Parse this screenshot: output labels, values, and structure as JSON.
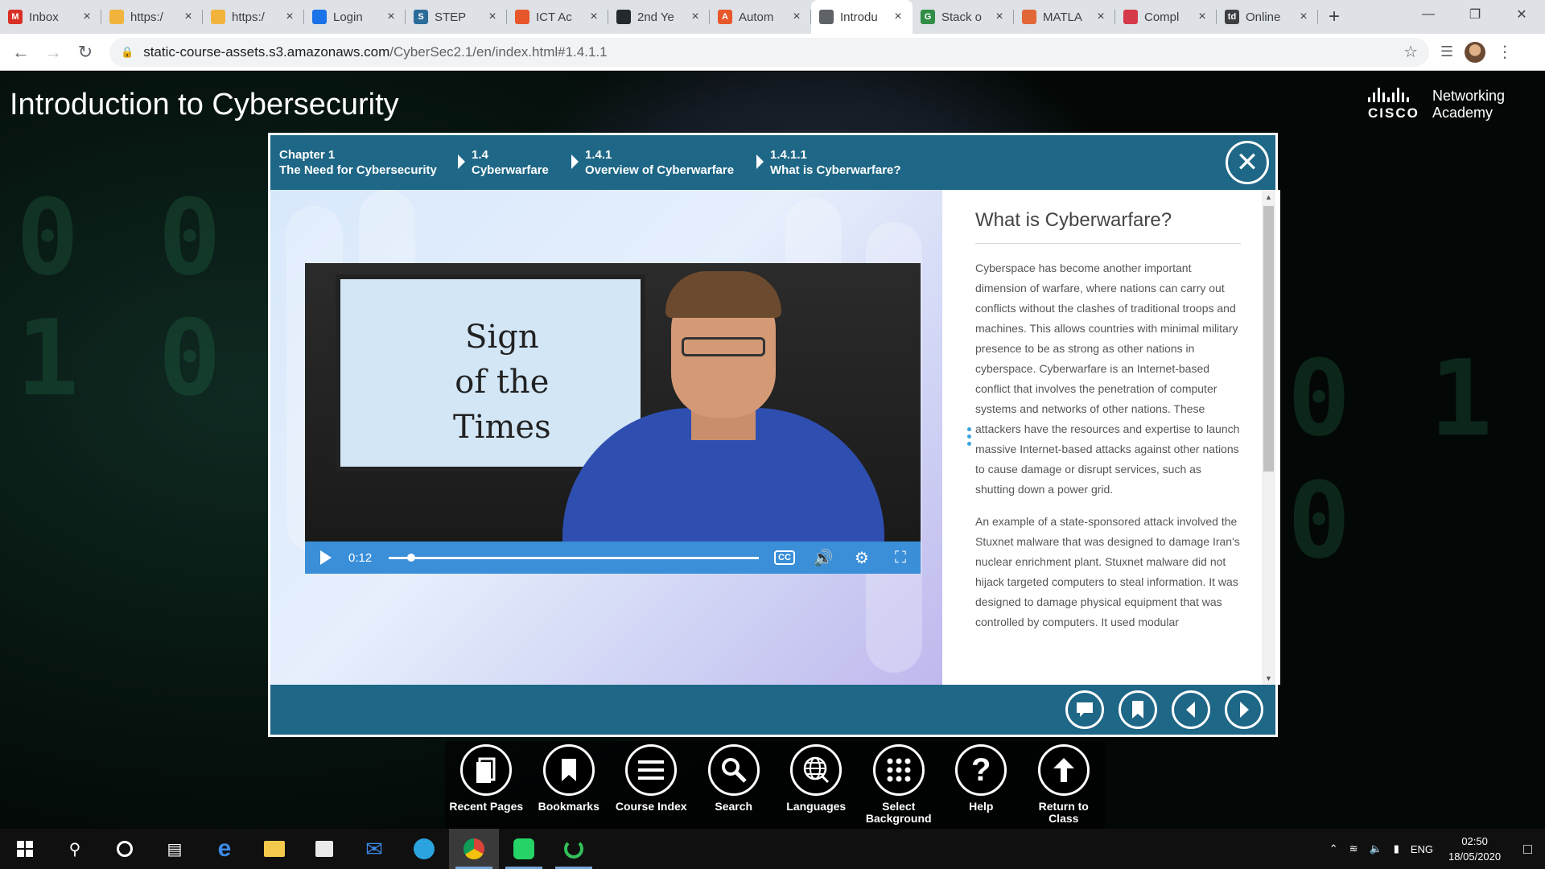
{
  "browser": {
    "tabs": [
      {
        "title": "Inbox",
        "icon": "gmail-icon",
        "color": "#d93025",
        "glyph": "M"
      },
      {
        "title": "https:/",
        "icon": "folder-icon",
        "color": "#f2b33d",
        "glyph": ""
      },
      {
        "title": "https:/",
        "icon": "folder-icon",
        "color": "#f2b33d",
        "glyph": ""
      },
      {
        "title": "Login",
        "icon": "cloud-icon",
        "color": "#1a73e8",
        "glyph": ""
      },
      {
        "title": "STEP",
        "icon": "step-icon",
        "color": "#2b6b9a",
        "glyph": "S"
      },
      {
        "title": "ICT Ac",
        "icon": "ict-icon",
        "color": "#e8572a",
        "glyph": ""
      },
      {
        "title": "2nd Ye",
        "icon": "github-icon",
        "color": "#24292e",
        "glyph": ""
      },
      {
        "title": "Autom",
        "icon": "automation-icon",
        "color": "#e8572a",
        "glyph": "A"
      },
      {
        "title": "Introdu",
        "icon": "globe-icon",
        "color": "#5f6368",
        "glyph": "",
        "active": true
      },
      {
        "title": "Stack o",
        "icon": "geeks-icon",
        "color": "#2f8d46",
        "glyph": "G"
      },
      {
        "title": "MATLA",
        "icon": "matlab-icon",
        "color": "#e16737",
        "glyph": ""
      },
      {
        "title": "Compl",
        "icon": "compiler-icon",
        "color": "#d6394a",
        "glyph": ""
      },
      {
        "title": "Online",
        "icon": "td-icon",
        "color": "#3c4043",
        "glyph": "td"
      }
    ],
    "url_host": "static-course-assets.s3.amazonaws.com",
    "url_path": "/CyberSec2.1/en/index.html#1.4.1.1"
  },
  "page": {
    "course_title": "Introduction to Cybersecurity",
    "logo_word": "CISCO",
    "logo_text_1": "Networking",
    "logo_text_2": "Academy",
    "bg_bits": [
      "0 0 1",
      "1 0 0",
      "0 1 0"
    ]
  },
  "breadcrumb": [
    {
      "num": "Chapter 1",
      "label": "The Need for Cybersecurity"
    },
    {
      "num": "1.4",
      "label": "Cyberwarfare"
    },
    {
      "num": "1.4.1",
      "label": "Overview of Cyberwarfare"
    },
    {
      "num": "1.4.1.1",
      "label": "What is Cyberwarfare?"
    }
  ],
  "video": {
    "tv_line1": "Sign",
    "tv_line2": "of the",
    "tv_line3": "Times",
    "timecode": "0:12",
    "progress": 0.06,
    "cc_label": "CC"
  },
  "article": {
    "title": "What is Cyberwarfare?",
    "paragraph1": "Cyberspace has become another important dimension of warfare, where nations can carry out conflicts without the clashes of traditional troops and machines. This allows countries with minimal military presence to be as strong as other nations in cyberspace. Cyberwarfare is an Internet-based conflict that involves the penetration of computer systems and networks of other nations. These attackers have the resources and expertise to launch massive Internet-based attacks against other nations to cause damage or disrupt services, such as shutting down a power grid.",
    "paragraph2": "An example of a state-sponsored attack involved the Stuxnet malware that was designed to damage Iran's nuclear enrichment plant. Stuxnet malware did not hijack targeted computers to steal information. It was designed to damage physical equipment that was controlled by computers. It used modular"
  },
  "dock": [
    {
      "label": "Recent Pages",
      "icon": "recent-pages-icon"
    },
    {
      "label": "Bookmarks",
      "icon": "bookmarks-icon"
    },
    {
      "label": "Course Index",
      "icon": "course-index-icon"
    },
    {
      "label": "Search",
      "icon": "search-icon"
    },
    {
      "label": "Languages",
      "icon": "languages-icon"
    },
    {
      "label": "Select Background",
      "icon": "select-background-icon"
    },
    {
      "label": "Help",
      "icon": "help-icon"
    },
    {
      "label": "Return to Class",
      "icon": "return-to-class-icon"
    }
  ],
  "taskbar": {
    "language": "ENG",
    "time": "02:50",
    "date": "18/05/2020"
  }
}
